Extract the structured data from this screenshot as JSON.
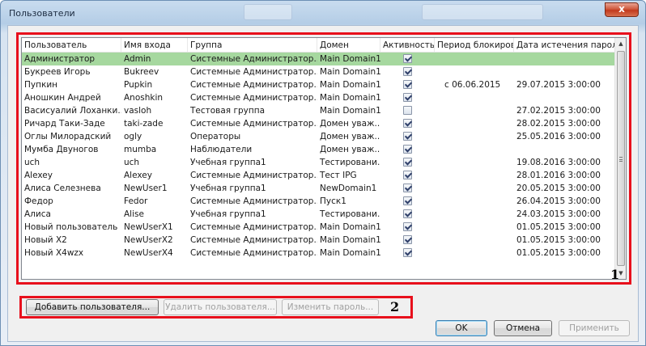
{
  "window": {
    "title": "Пользователи",
    "close_glyph": "x"
  },
  "grid": {
    "columns": [
      "Пользователь",
      "Имя входа",
      "Группа",
      "Домен",
      "Активность",
      "Период блокиров",
      "Дата истечения пароля"
    ],
    "rows": [
      {
        "user": "Администратор",
        "login": "Admin",
        "group": "Системные Администратор...",
        "domain": "Main Domain1",
        "active": true,
        "lock_period": "",
        "password_expiry": "",
        "selected": true
      },
      {
        "user": "Букреев Игорь",
        "login": "Bukreev",
        "group": "Системные Администратор...",
        "domain": "Main Domain1",
        "active": true,
        "lock_period": "",
        "password_expiry": ""
      },
      {
        "user": "Пупкин",
        "login": "Pupkin",
        "group": "Системные Администратор...",
        "domain": "Main Domain1",
        "active": true,
        "lock_period": "с 06.06.2015",
        "password_expiry": "29.07.2015 3:00:00"
      },
      {
        "user": "Аношкин Андрей",
        "login": "Anoshkin",
        "group": "Системные Администратор...",
        "domain": "Main Domain1",
        "active": true,
        "lock_period": "",
        "password_expiry": ""
      },
      {
        "user": "Васисуалий Лоханки...",
        "login": "vasloh",
        "group": "Тестовая группа",
        "domain": "Main Domain1",
        "active": false,
        "lock_period": "",
        "password_expiry": "27.02.2015 3:00:00"
      },
      {
        "user": "Ричард Таки-Заде",
        "login": "taki-zade",
        "group": "Системные Администратор...",
        "domain": "Домен уваж...",
        "active": true,
        "lock_period": "",
        "password_expiry": "28.02.2015 3:00:00"
      },
      {
        "user": "Оглы Милорадский",
        "login": "ogly",
        "group": "Операторы",
        "domain": "Домен уваж...",
        "active": true,
        "lock_period": "",
        "password_expiry": "25.05.2016 3:00:00"
      },
      {
        "user": "Мумба Двуногов",
        "login": "mumba",
        "group": "Наблюдатели",
        "domain": "Домен уваж...",
        "active": true,
        "lock_period": "",
        "password_expiry": ""
      },
      {
        "user": "uch",
        "login": "uch",
        "group": "Учебная группа1",
        "domain": "Тестировани...",
        "active": true,
        "lock_period": "",
        "password_expiry": "19.08.2016 3:00:00"
      },
      {
        "user": "Alexey",
        "login": "Alexey",
        "group": "Системные Администратор...",
        "domain": "Тест IPG",
        "active": true,
        "lock_period": "",
        "password_expiry": "28.01.2016 3:00:00"
      },
      {
        "user": "Алиса Селезнева",
        "login": "NewUser1",
        "group": "Учебная группа1",
        "domain": "NewDomain1",
        "active": true,
        "lock_period": "",
        "password_expiry": "20.05.2015 3:00:00"
      },
      {
        "user": "Федор",
        "login": "Fedor",
        "group": "Системные Администратор...",
        "domain": "Пуск1",
        "active": true,
        "lock_period": "",
        "password_expiry": "26.04.2015 3:00:00"
      },
      {
        "user": "Алиса",
        "login": "Alise",
        "group": "Учебная группа1",
        "domain": "Тестировани...",
        "active": true,
        "lock_period": "",
        "password_expiry": "24.03.2015 3:00:00"
      },
      {
        "user": "Новый пользователь",
        "login": "NewUserX1",
        "group": "Системные Администратор...",
        "domain": "Main Domain1",
        "active": true,
        "lock_period": "",
        "password_expiry": "01.05.2015 3:00:00"
      },
      {
        "user": "Новый X2",
        "login": "NewUserX2",
        "group": "Системные Администратор...",
        "domain": "Main Domain1",
        "active": true,
        "lock_period": "",
        "password_expiry": "01.05.2015 3:00:00"
      },
      {
        "user": "Новый X4wzx",
        "login": "NewUserX4",
        "group": "Системные Администратор...",
        "domain": "Main Domain1",
        "active": true,
        "lock_period": "",
        "password_expiry": "01.05.2015 3:00:00"
      }
    ]
  },
  "markers": {
    "grid": "1",
    "buttons": "2"
  },
  "actions": {
    "add_user": "Добавить пользователя...",
    "delete_user": "Удалить пользователя...",
    "change_password": "Изменить пароль..."
  },
  "footer": {
    "ok": "OK",
    "cancel": "Отмена",
    "apply": "Применить"
  },
  "colors": {
    "selection": "#a6d89f",
    "highlight_frame": "#e8101c"
  }
}
